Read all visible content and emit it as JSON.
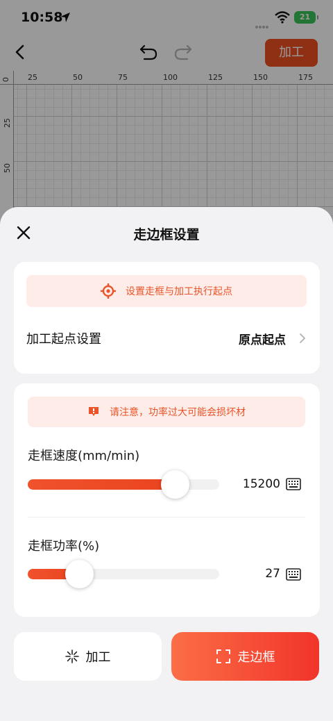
{
  "status_bar": {
    "time": "10:58",
    "battery": "21"
  },
  "toolbar": {
    "process_label": "加工"
  },
  "ruler": {
    "top_ticks": [
      "0",
      "25",
      "50",
      "75",
      "100",
      "125",
      "150",
      "175"
    ],
    "left_ticks": [
      "25",
      "50"
    ]
  },
  "sheet": {
    "title": "走边框设置",
    "start_card": {
      "notice": "设置走框与加工执行起点",
      "row_label": "加工起点设置",
      "row_value": "原点起点"
    },
    "power_card": {
      "warning": "请注意，功率过大可能会损坏材",
      "speed": {
        "label": "走框速度(mm/min)",
        "value": "15200",
        "fraction": 0.77
      },
      "power": {
        "label": "走框功率(%)",
        "value": "27",
        "fraction": 0.27
      }
    },
    "buttons": {
      "process": "加工",
      "frame": "走边框"
    }
  },
  "colors": {
    "accent": "#ee4f22",
    "notice_bg": "#fdece7",
    "gradient_start": "#fb6e46",
    "gradient_end": "#f1342a"
  }
}
